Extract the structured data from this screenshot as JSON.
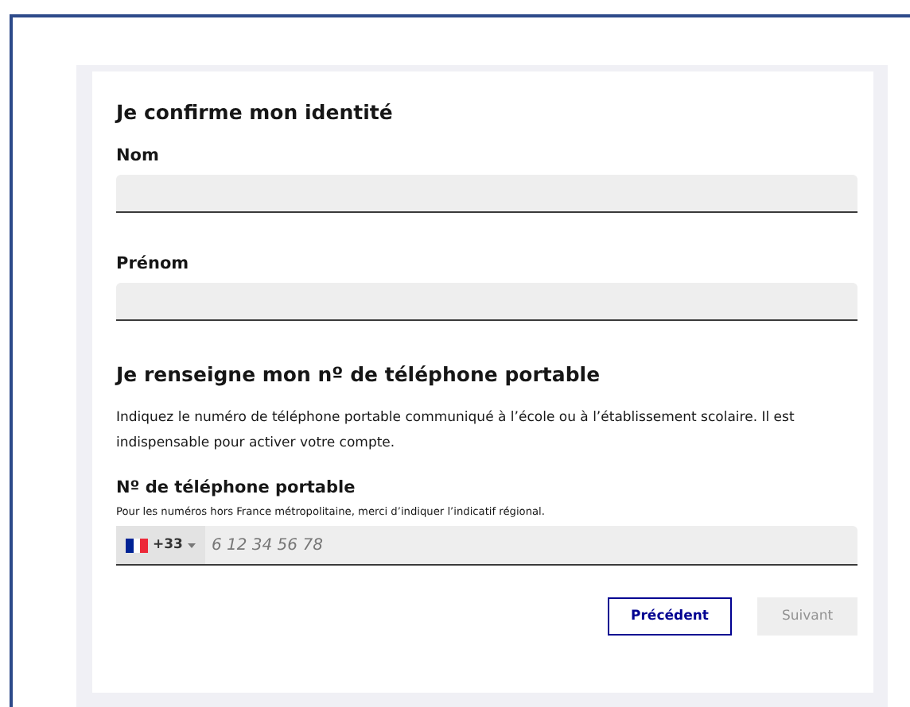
{
  "identity": {
    "title": "Je confirme mon identité",
    "fields": [
      {
        "label": "Nom"
      },
      {
        "label": "Prénom"
      }
    ]
  },
  "phone_section": {
    "title": "Je renseigne mon nº de téléphone portable",
    "description": "Indiquez le numéro de téléphone portable communiqué à l’école ou à l’établissement scolaire. Il est indispensable pour activer votre compte.",
    "label": "Nº de téléphone portable",
    "hint": "Pour les numéros hors France métropolitaine, merci d’indiquer l’indicatif régional.",
    "country_code": "+33",
    "placeholder": "6 12 34 56 78"
  },
  "buttons": [
    {
      "label": "Précédent",
      "disabled": false
    },
    {
      "label": "Suivant",
      "disabled": true
    }
  ]
}
